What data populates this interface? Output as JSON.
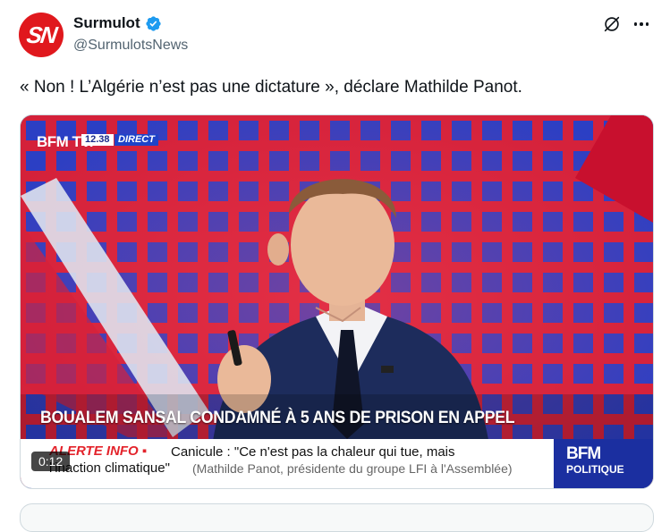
{
  "author": {
    "avatar_text": "SN",
    "display_name": "Surmulot",
    "handle": "@SurmulotsNews",
    "verified": true
  },
  "icons": {
    "grok": "grok-icon",
    "more": "more-options-icon",
    "verified": "verified-badge-icon"
  },
  "tweet": {
    "text": "« Non ! L’Algérie n’est pas une dictature », déclare Mathilde Panot."
  },
  "video": {
    "channel_logo": "BFM TV.",
    "live_time": "12.38",
    "live_label": "DIRECT",
    "headline": "BOUALEM SANSAL CONDAMNÉ À 5 ANS DE PRISON EN APPEL",
    "ticker_label": "ALERTE INFO ▪",
    "ticker_line1": "Canicule : \"Ce n'est pas la chaleur qui tue, mais",
    "ticker_line2_quote": "l'inaction climatique\"",
    "ticker_line2_attribution": "(Mathilde Panot, présidente du groupe LFI à l'Assemblée)",
    "channel_brand_top": "BFM",
    "channel_brand_bottom": "POLITIQUE",
    "timer": "0:12"
  },
  "colors": {
    "avatar_bg": "#e0181d",
    "verified": "#1d9bf0",
    "studio_blue": "#1c2a7a",
    "studio_red": "#d4213a",
    "alert_red": "#e3232b",
    "bfm_politique_blue": "#1b2fa0"
  }
}
